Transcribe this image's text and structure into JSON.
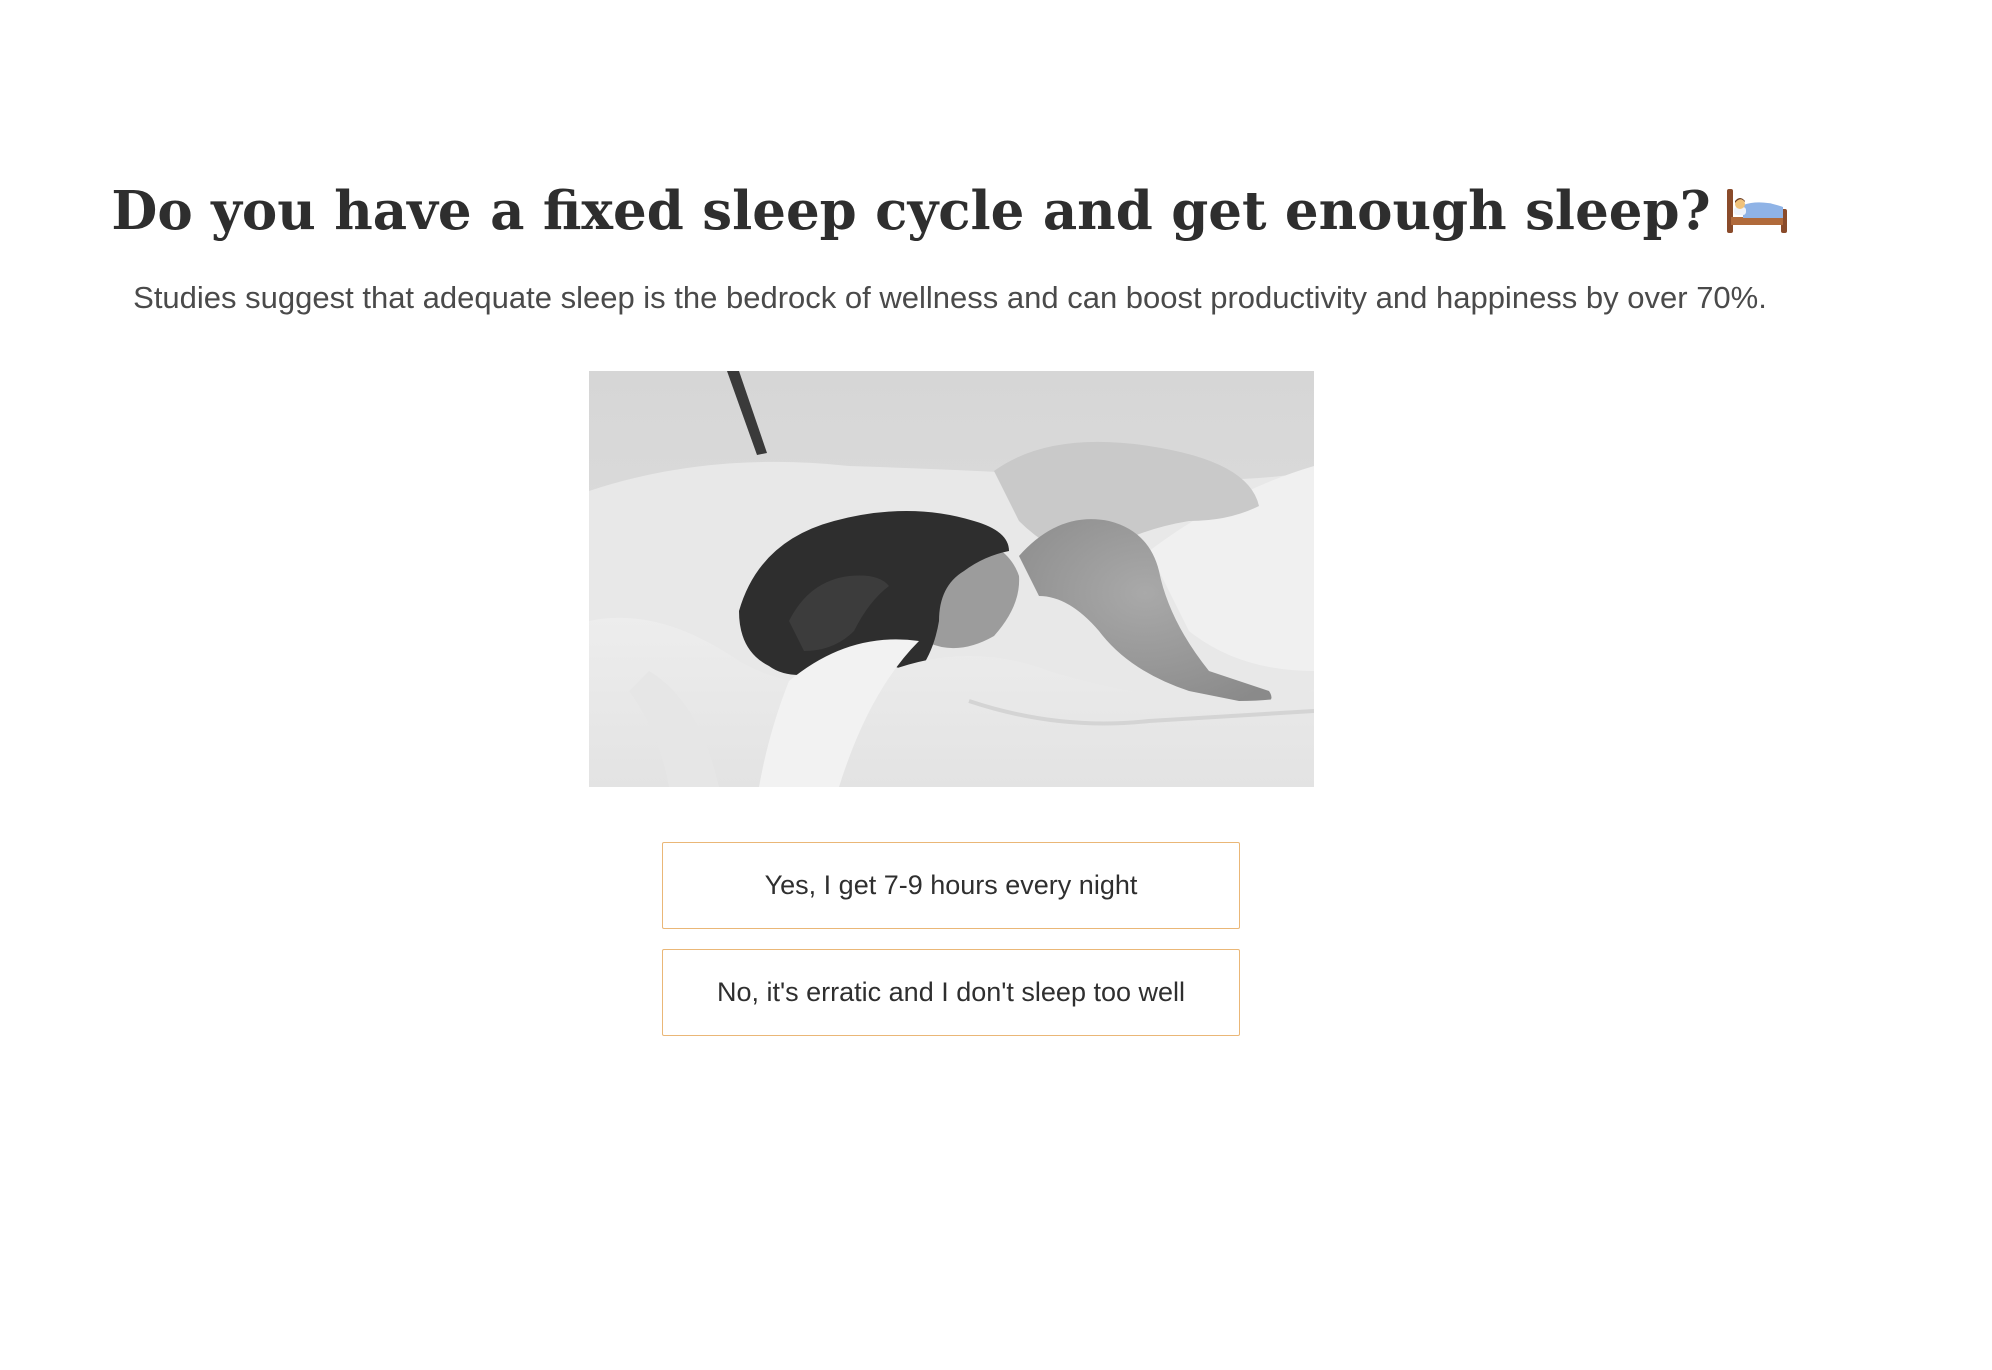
{
  "question": {
    "title": "Do you have a fixed sleep cycle and get enough sleep?",
    "title_icon": "bed-icon",
    "subtitle": "Studies suggest that adequate sleep is the bedrock of wellness and can boost productivity and happiness by over 70%."
  },
  "image": {
    "subject": "person sleeping in bed",
    "style": "black-and-white photograph"
  },
  "answers": [
    {
      "label": "Yes, I get 7-9 hours every night"
    },
    {
      "label": "No, it's erratic and I don't sleep too well"
    }
  ],
  "colors": {
    "title": "#2e2e2e",
    "subtitle": "#4a4a4a",
    "answer_border": "#eab777",
    "background": "#ffffff"
  }
}
